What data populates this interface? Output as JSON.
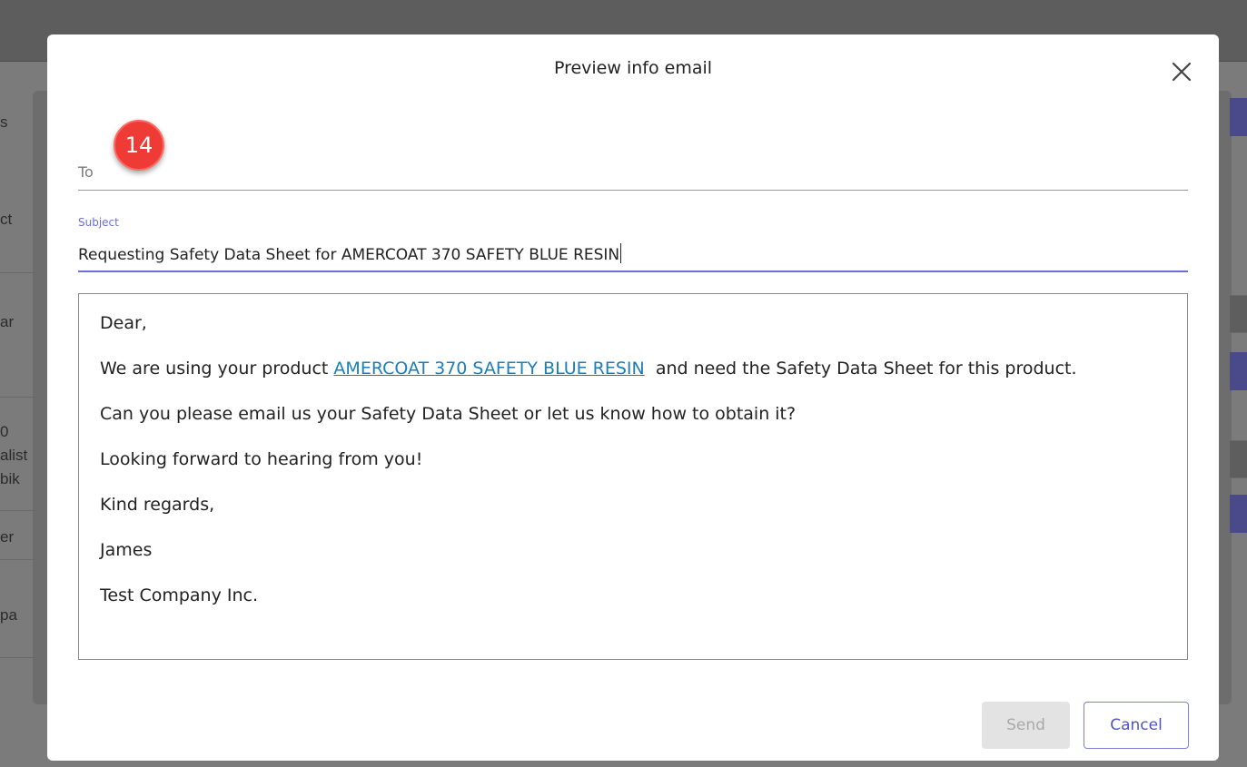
{
  "background": {
    "fragments": [
      "s",
      "ct",
      "ar",
      "0",
      "alist",
      "bik",
      "er",
      "pa"
    ]
  },
  "modal": {
    "title": "Preview info email",
    "close_icon": "close-icon",
    "badge_number": "14",
    "to_label": "To",
    "subject_label": "Subject",
    "subject_value": "Requesting Safety Data Sheet for AMERCOAT 370 SAFETY BLUE RESIN",
    "body": {
      "greeting": "Dear,",
      "line1_before": "We are using your product ",
      "product_link": "AMERCOAT 370 SAFETY BLUE RESIN",
      "line1_after": "  and need the Safety Data Sheet for this product.",
      "line2": "Can you please email us your Safety Data Sheet or let us know how to obtain it?",
      "line3": "Looking forward to hearing from you!",
      "closing": "Kind regards,",
      "name": "James",
      "company": "Test Company Inc."
    },
    "send_label": "Send",
    "cancel_label": "Cancel"
  },
  "colors": {
    "accent": "#6b6fd8",
    "badge": "#ef3b35",
    "link": "#1a7fb8"
  }
}
